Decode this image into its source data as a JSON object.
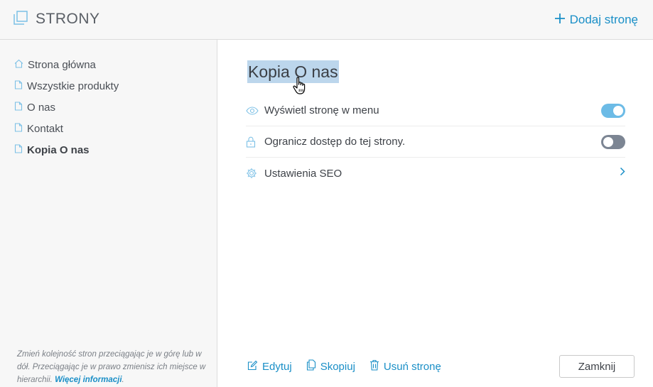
{
  "header": {
    "title": "STRONY",
    "add_page_label": "Dodaj stronę"
  },
  "sidebar": {
    "items": [
      {
        "label": "Strona główna",
        "icon": "home-icon"
      },
      {
        "label": "Wszystkie produkty",
        "icon": "page-icon"
      },
      {
        "label": "O nas",
        "icon": "page-icon"
      },
      {
        "label": "Kontakt",
        "icon": "page-icon"
      },
      {
        "label": "Kopia O nas",
        "icon": "page-icon",
        "active": true
      }
    ],
    "hint": "Zmień kolejność stron przeciągając je w górę lub w dół. Przeciągając je w prawo zmienisz ich miejsce w hierarchii.",
    "hint_link": "Więcej informacji",
    "hint_end": "."
  },
  "main": {
    "page_title": "Kopia O nas",
    "settings": [
      {
        "label": "Wyświetl stronę w menu",
        "icon": "eye-icon",
        "toggle": true
      },
      {
        "label": "Ogranicz dostęp do tej strony.",
        "icon": "lock-icon",
        "toggle": false
      },
      {
        "label": "Ustawienia SEO",
        "icon": "gear-icon"
      }
    ],
    "actions": {
      "edit": "Edytuj",
      "copy": "Skopiuj",
      "delete": "Usuń stronę"
    },
    "close_label": "Zamknij"
  },
  "colors": {
    "accent": "#1a8fc7",
    "toggle_on": "#6cbbe6",
    "toggle_off": "#7c8593",
    "selection": "#bcd6ec"
  }
}
